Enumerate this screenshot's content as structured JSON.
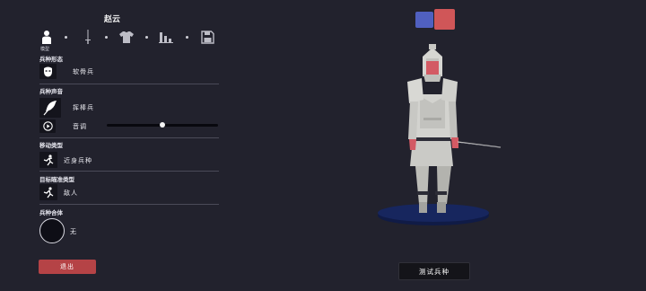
{
  "unit_name": "赵云",
  "tabs": [
    {
      "icon": "person-icon",
      "label": "模型"
    },
    {
      "icon": "sword-icon"
    },
    {
      "icon": "armor-icon"
    },
    {
      "icon": "stats-icon"
    },
    {
      "icon": "save-icon"
    }
  ],
  "sections": {
    "form": {
      "label": "兵种形态",
      "value": "软骨兵",
      "icon": "mask-icon"
    },
    "voice": {
      "label": "兵种声音",
      "value": "挥棒兵",
      "icon": "feather-icon",
      "pitch_label": "音调",
      "pitch_level": 0.5
    },
    "movement": {
      "label": "移动类型",
      "value": "近身兵种",
      "icon": "running-figure-icon"
    },
    "targeting": {
      "label": "目标瞄准类型",
      "value": "敌人",
      "icon": "target-figure-icon"
    },
    "merge": {
      "label": "兵种合体",
      "value": "无"
    }
  },
  "team_colors": [
    "#5060c0",
    "#d05658"
  ],
  "exit_label": "退出",
  "test_label": "测试兵种"
}
